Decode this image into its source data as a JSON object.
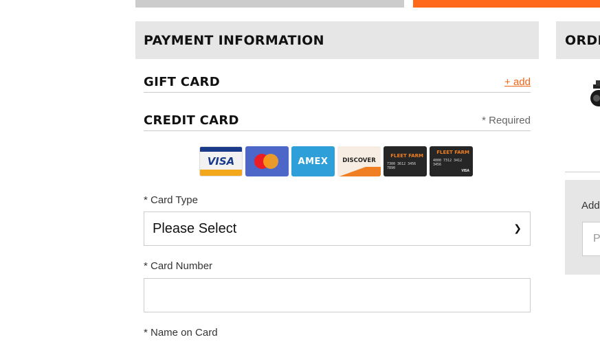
{
  "top": {
    "colors": {
      "gray_tab": "#cccccc",
      "orange_tab": "#ff6a1a"
    }
  },
  "payment": {
    "title": "PAYMENT INFORMATION",
    "gift_card": {
      "title": "GIFT CARD",
      "add_label": "+ add"
    },
    "credit_card": {
      "title": "CREDIT CARD",
      "required_note": "* Required",
      "accepted_cards": [
        {
          "name": "visa-card-logo",
          "label": "VISA"
        },
        {
          "name": "mastercard-card-logo",
          "label": ""
        },
        {
          "name": "amex-card-logo",
          "label": "AMEX"
        },
        {
          "name": "discover-card-logo",
          "label": "DISCOVER"
        },
        {
          "name": "farm-card-logo",
          "label": "FLEET FARM"
        },
        {
          "name": "farm-visa-card-logo",
          "label": "FLEET FARM"
        }
      ]
    },
    "fields": {
      "card_type_label": "* Card Type",
      "card_type_value": "Please Select",
      "card_number_label": "* Card Number",
      "card_number_value": "",
      "name_on_card_label": "* Name on Card"
    },
    "accent_color": "#f06414"
  },
  "order": {
    "title": "ORDER SUMMARY",
    "promo_label": "Add Promo Code",
    "promo_placeholder": "Promo Code"
  }
}
